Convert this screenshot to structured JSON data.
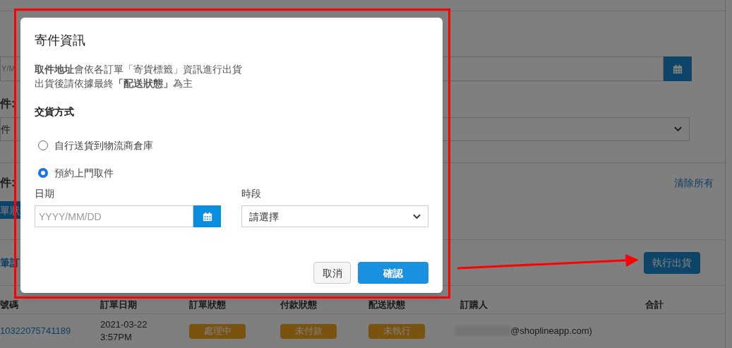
{
  "page": {
    "date_field": {
      "placeholder": "Y/M"
    },
    "filter_labels": [
      "件:",
      "件:"
    ],
    "select": {
      "value": "件"
    },
    "status_button": "單狀",
    "clear_all": "清除所有",
    "order_count": "筆訂",
    "ship_button": "執行出貨",
    "table": {
      "columns": [
        "號碼",
        "訂單日期",
        "訂單狀態",
        "付款狀態",
        "配送狀態",
        "訂購人",
        "合計"
      ],
      "rows": [
        {
          "order_no": "10322075741189",
          "date": "2021-03-22",
          "time": "3:57PM",
          "order_status": "處理中",
          "payment_status": "未付款",
          "delivery_status": "未執行",
          "customer": "@shoplineapp.com)"
        }
      ]
    }
  },
  "dialog": {
    "title": "寄件資訊",
    "notes": [
      "**取件地址**會依各訂單「寄貨標籤」資訊進行出貨",
      "出貨後請依據最終**「配送狀態」**為主"
    ],
    "section_title": "交貨方式",
    "options": [
      {
        "label": "自行送貨到物流商倉庫",
        "selected": false
      },
      {
        "label": "預約上門取件",
        "selected": true
      }
    ],
    "date_field": {
      "label": "日期",
      "placeholder": "YYYY/MM/DD"
    },
    "time_field": {
      "label": "時段",
      "value": "請選擇"
    },
    "buttons": [
      {
        "label": "取消",
        "kind": "secondary"
      },
      {
        "label": "確認",
        "kind": "primary"
      }
    ]
  }
}
